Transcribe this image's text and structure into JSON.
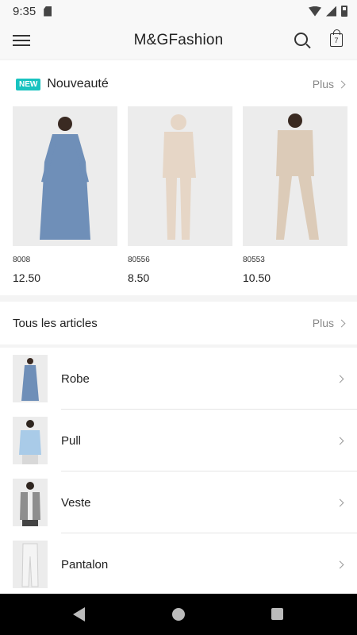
{
  "status_bar": {
    "time": "9:35"
  },
  "header": {
    "title": "M&GFashion",
    "cart_count": "7"
  },
  "new_section": {
    "badge": "NEW",
    "title": "Nouveauté",
    "more_label": "Plus",
    "products": [
      {
        "ref": "8008",
        "price": "12.50",
        "color": "#6f8fb8"
      },
      {
        "ref": "80556",
        "price": "8.50",
        "color": "#e6d6c6"
      },
      {
        "ref": "80553",
        "price": "10.50",
        "color": "#dccbb8"
      }
    ]
  },
  "all_section": {
    "title": "Tous les articles",
    "more_label": "Plus"
  },
  "categories": [
    {
      "label": "Robe",
      "color": "#6f8fb8"
    },
    {
      "label": "Pull",
      "color": "#a9cbe8"
    },
    {
      "label": "Veste",
      "color": "#8e8e8e"
    },
    {
      "label": "Pantalon",
      "color": "#f4f4f4"
    }
  ]
}
